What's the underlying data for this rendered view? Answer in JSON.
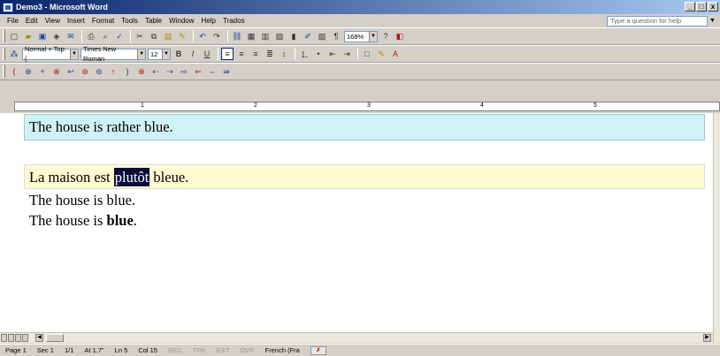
{
  "window": {
    "title": "Demo3 - Microsoft Word",
    "controls": [
      "_",
      "□",
      "x"
    ]
  },
  "menubar": {
    "items": [
      "File",
      "Edit",
      "View",
      "Insert",
      "Format",
      "Tools",
      "Table",
      "Window",
      "Help",
      "Trados"
    ],
    "help_placeholder": "Type a question for help"
  },
  "toolbar_standard": {
    "zoom": "168%"
  },
  "toolbar_formatting": {
    "style": "Normal + Top: (",
    "font": "Times New Roman",
    "size": "12"
  },
  "ruler": {
    "numbers": [
      "1",
      "2",
      "3",
      "4",
      "5"
    ]
  },
  "document": {
    "p1": "The house is rather blue.",
    "p2_before": "La maison est ",
    "p2_selected": "plutôt",
    "p2_after": " bleue.",
    "p3": "The house is blue.",
    "p4_before": "The house is ",
    "p4_bold": "blue",
    "p4_after": "."
  },
  "statusbar": {
    "page": "Page 1",
    "sec": "Sec 1",
    "pages": "1/1",
    "at": "At 1.7\"",
    "ln": "Ln 5",
    "col": "Col 15",
    "rec": "REC",
    "trk": "TRK",
    "ext": "EXT",
    "ovr": "OVR",
    "language": "French (Fra"
  },
  "colors": {
    "titlebar_start": "#0a246a",
    "highlight_blue": "#cff2f4",
    "highlight_yellow": "#fffad0",
    "selection": "#0b0b3a"
  }
}
